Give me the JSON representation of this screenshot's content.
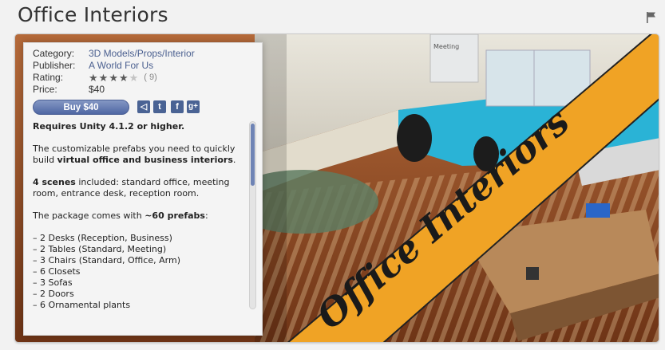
{
  "title": "Office Interiors",
  "meta": {
    "category_label": "Category:",
    "category_value": "3D Models/Props/Interior",
    "publisher_label": "Publisher:",
    "publisher_value": "A World For Us",
    "rating_label": "Rating:",
    "rating_stars": 4,
    "rating_max": 5,
    "rating_count": "( 9)",
    "price_label": "Price:",
    "price_value": "$40"
  },
  "buy_label": "Buy $40",
  "social_icons": [
    "unity-share-icon",
    "twitter-icon",
    "facebook-icon",
    "google-plus-icon"
  ],
  "social_glyphs": [
    "◁",
    "t",
    "f",
    "g+"
  ],
  "banner_text": "Office Interiors",
  "whiteboard_text": "Meeting",
  "description": {
    "requires": "Requires Unity 4.1.2 or higher.",
    "intro_1": "The customizable prefabs you need to quickly build ",
    "intro_bold": "virtual office and business interiors",
    "intro_2": ".",
    "scenes_bold": "4 scenes",
    "scenes_rest": " included: standard office, meeting room, entrance desk, reception room.",
    "prefabs_1": "The package comes with ",
    "prefabs_bold": "~60 prefabs",
    "prefabs_2": ":",
    "list": [
      "– 2 Desks (Reception, Business)",
      "– 2 Tables (Standard, Meeting)",
      "– 3 Chairs (Standard, Office, Arm)",
      "– 6 Closets",
      "– 3 Sofas",
      "– 2 Doors",
      "– 6 Ornamental plants"
    ]
  },
  "colors": {
    "link": "#4a5f8f",
    "button": "#5a6fa8",
    "banner": "#f0a325",
    "wall": "#2ab3d6"
  }
}
